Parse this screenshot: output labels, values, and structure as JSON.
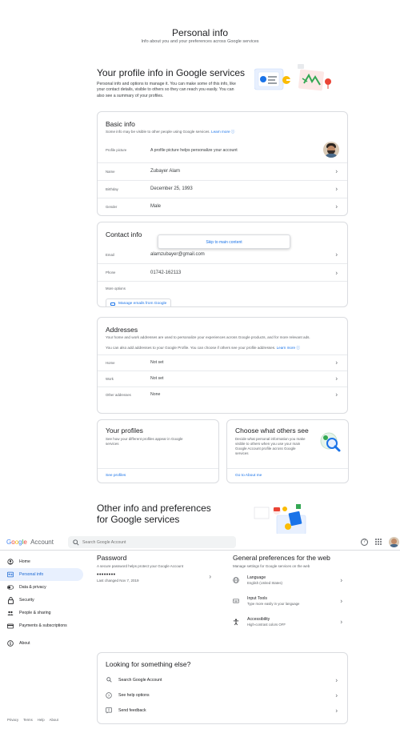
{
  "header": {
    "title": "Personal info",
    "subtitle": "Info about you and your preferences across Google services"
  },
  "profile_section": {
    "title": "Your profile info in Google services",
    "description": "Personal info and options to manage it. You can make some of this info, like your contact details, visible to others so they can reach you easily. You can also see a summary of your profiles."
  },
  "basic_info": {
    "title": "Basic info",
    "description": "Some info may be visible to other people using Google services.",
    "learn_more": "Learn more",
    "rows": [
      {
        "label": "Profile picture",
        "value": "A profile picture helps personalize your account"
      },
      {
        "label": "Name",
        "value": "Zubayer Alam"
      },
      {
        "label": "Birthday",
        "value": "December 25, 1993"
      },
      {
        "label": "Gender",
        "value": "Male"
      }
    ]
  },
  "contact_info": {
    "title": "Contact info",
    "skip_link": "Skip to main content",
    "rows": [
      {
        "label": "Email",
        "value": "alamzubayer@gmail.com"
      },
      {
        "label": "Phone",
        "value": "01742-162113"
      }
    ],
    "more_options": "More options",
    "manage_button": "Manage emails from Google"
  },
  "addresses": {
    "title": "Addresses",
    "description": "Your home and work addresses are used to personalize your experiences across Google products, and for more relevant ads.",
    "note": "You can also add addresses to your Google Profile. You can choose if others see your profile addresses.",
    "learn_more": "Learn more",
    "rows": [
      {
        "label": "Home",
        "value": "Not set"
      },
      {
        "label": "Work",
        "value": "Not set"
      },
      {
        "label": "Other addresses",
        "value": "None"
      }
    ]
  },
  "your_profiles": {
    "title": "Your profiles",
    "description": "See how your different profiles appear in Google services",
    "link": "See profiles"
  },
  "choose_others": {
    "title": "Choose what others see",
    "description": "Decide what personal information you make visible to others when you use your main Google Account profile across Google services",
    "link": "Go to About me"
  },
  "other_info": {
    "title": "Other info and preferences for Google services"
  },
  "appbar": {
    "logo": "Google",
    "logo_suffix": "Account",
    "search_placeholder": "Search Google Account",
    "help": "?"
  },
  "sidebar": {
    "items": [
      {
        "label": "Home",
        "icon": "home-icon"
      },
      {
        "label": "Personal info",
        "icon": "id-card-icon",
        "active": true
      },
      {
        "label": "Data & privacy",
        "icon": "toggle-icon"
      },
      {
        "label": "Security",
        "icon": "lock-icon"
      },
      {
        "label": "People & sharing",
        "icon": "people-icon"
      },
      {
        "label": "Payments & subscriptions",
        "icon": "card-icon"
      },
      {
        "label": "About",
        "icon": "info-icon"
      }
    ],
    "footer": [
      "Privacy",
      "Terms",
      "Help",
      "About"
    ]
  },
  "password": {
    "title": "Password",
    "description": "A secure password helps protect your Google Account",
    "masked": "••••••••",
    "last_changed": "Last changed Nov 7, 2019"
  },
  "general_prefs": {
    "title": "General preferences for the web",
    "description": "Manage settings for Google services on the web",
    "rows": [
      {
        "title": "Language",
        "sub": "English (United States)",
        "icon": "globe-icon"
      },
      {
        "title": "Input Tools",
        "sub": "Type more easily in your language",
        "icon": "keyboard-icon"
      },
      {
        "title": "Accessibility",
        "sub": "High-contrast colors OFF",
        "icon": "accessibility-icon"
      }
    ]
  },
  "looking": {
    "title": "Looking for something else?",
    "rows": [
      {
        "label": "Search Google Account",
        "icon": "search-icon"
      },
      {
        "label": "See help options",
        "icon": "help-icon"
      },
      {
        "label": "Send feedback",
        "icon": "feedback-icon"
      }
    ]
  },
  "colors": {
    "accent": "#1a73e8",
    "active_nav_bg": "#e8f0fe",
    "border": "#dadce0"
  }
}
